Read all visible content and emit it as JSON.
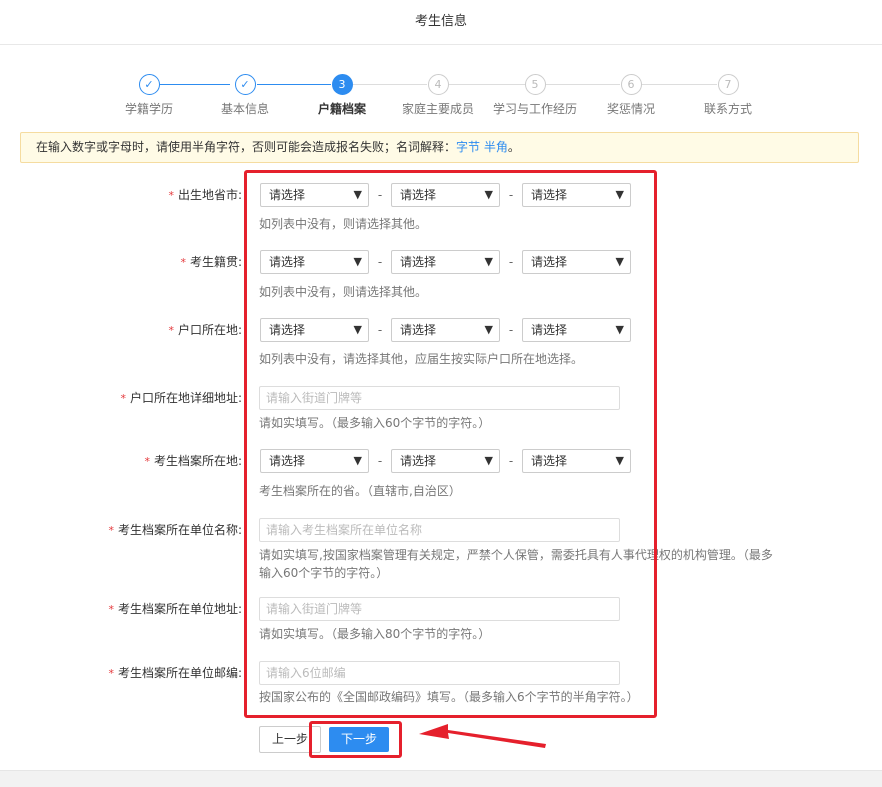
{
  "header": {
    "title": "考生信息"
  },
  "steps": [
    {
      "label": "学籍学历",
      "marker": "✓",
      "state": "done"
    },
    {
      "label": "基本信息",
      "marker": "✓",
      "state": "done"
    },
    {
      "label": "户籍档案",
      "marker": "3",
      "state": "active"
    },
    {
      "label": "家庭主要成员",
      "marker": "4",
      "state": "todo"
    },
    {
      "label": "学习与工作经历",
      "marker": "5",
      "state": "todo"
    },
    {
      "label": "奖惩情况",
      "marker": "6",
      "state": "todo"
    },
    {
      "label": "联系方式",
      "marker": "7",
      "state": "todo"
    }
  ],
  "notice": {
    "text": "在输入数字或字母时，请使用半角字符，否则可能会造成报名失败；名词解释：",
    "link": "字节 半角",
    "suffix": "。"
  },
  "required_mark": "*",
  "select_placeholder": "请选择",
  "select_arrow": "▼",
  "dash": "-",
  "form": {
    "birthplace": {
      "label": "出生地省市:",
      "hint": "如列表中没有，则请选择其他。"
    },
    "native_place": {
      "label": "考生籍贯:",
      "hint": "如列表中没有，则请选择其他。"
    },
    "hukou": {
      "label": "户口所在地:",
      "hint": "如列表中没有，请选择其他，应届生按实际户口所在地选择。"
    },
    "hukou_address": {
      "label": "户口所在地详细地址:",
      "placeholder": "请输入街道门牌等",
      "hint": "请如实填写。（最多输入60个字节的字符。）"
    },
    "archive_location": {
      "label": "考生档案所在地:",
      "hint": "考生档案所在的省。（直辖市,自治区）"
    },
    "archive_unit_name": {
      "label": "考生档案所在单位名称:",
      "placeholder": "请输入考生档案所在单位名称",
      "hint": "请如实填写,按国家档案管理有关规定，严禁个人保管，需委托具有人事代理权的机构管理。（最多输入60个字节的字符。）"
    },
    "archive_unit_address": {
      "label": "考生档案所在单位地址:",
      "placeholder": "请输入街道门牌等",
      "hint": "请如实填写。（最多输入80个字节的字符。）"
    },
    "archive_unit_postcode": {
      "label": "考生档案所在单位邮编:",
      "placeholder": "请输入6位邮编",
      "hint": "按国家公布的《全国邮政编码》填写。（最多输入6个字节的半角字符。）"
    }
  },
  "buttons": {
    "prev": "上一步",
    "next": "下一步"
  },
  "colors": {
    "accent": "#2d8cf0",
    "highlight": "#e5202c",
    "notice_bg": "#fffbe6"
  }
}
